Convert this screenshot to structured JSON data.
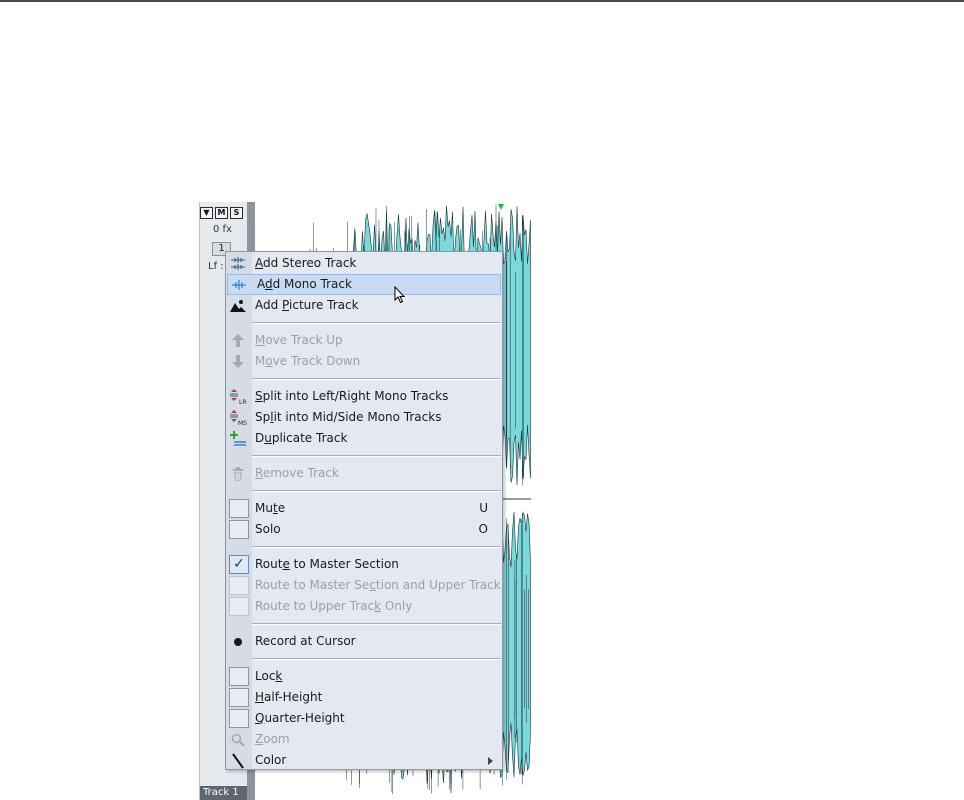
{
  "track": {
    "buttons": [
      "▼",
      "M",
      "S"
    ],
    "fx_label": "0 fx",
    "number": "1",
    "lf_label": "Lf :",
    "name": "Track 1"
  },
  "colors": {
    "waveform_fill": "#7dd8dc",
    "waveform_stroke": "#14353a",
    "menu_background": "#e4e9f1",
    "menu_highlight": "#c8dbf2",
    "disabled_text": "#9aa0a7"
  },
  "context_menu": {
    "groups": [
      [
        {
          "pre": "",
          "u": "A",
          "post": "dd Stereo Track",
          "icon": "stereo-track-icon",
          "disabled": false
        },
        {
          "pre": "A",
          "u": "d",
          "post": "d Mono Track",
          "icon": "mono-track-icon",
          "disabled": false,
          "highlighted": true
        },
        {
          "pre": "Add ",
          "u": "P",
          "post": "icture Track",
          "icon": "picture-track-icon",
          "disabled": false
        }
      ],
      [
        {
          "pre": "",
          "u": "M",
          "post": "ove Track Up",
          "icon": "arrow-up-icon",
          "disabled": true
        },
        {
          "pre": "M",
          "u": "o",
          "post": "ve Track Down",
          "icon": "arrow-down-icon",
          "disabled": true
        }
      ],
      [
        {
          "pre": "",
          "u": "S",
          "post": "plit into Left/Right Mono Tracks",
          "icon": "split-lr-icon",
          "disabled": false
        },
        {
          "pre": "Sp",
          "u": "l",
          "post": "it into Mid/Side Mono Tracks",
          "icon": "split-ms-icon",
          "disabled": false
        },
        {
          "pre": "D",
          "u": "u",
          "post": "plicate Track",
          "icon": "duplicate-track-icon",
          "disabled": false
        }
      ],
      [
        {
          "pre": "",
          "u": "R",
          "post": "emove Track",
          "icon": "trash-icon",
          "disabled": true
        }
      ],
      [
        {
          "pre": "Mu",
          "u": "t",
          "post": "e",
          "check": "unchecked",
          "shortcut": "U",
          "disabled": false
        },
        {
          "pre": "Solo",
          "u": "",
          "post": "",
          "check": "unchecked",
          "shortcut": "O",
          "disabled": false
        }
      ],
      [
        {
          "pre": "Rout",
          "u": "e",
          "post": " to Master Section",
          "check": "checked",
          "disabled": false
        },
        {
          "pre": "Route to Master Se",
          "u": "c",
          "post": "tion and Upper Track",
          "check": "unchecked",
          "disabled": true
        },
        {
          "pre": "Route to Upper Trac",
          "u": "k",
          "post": " Only",
          "check": "unchecked",
          "disabled": true
        }
      ],
      [
        {
          "pre": "Record at Cursor",
          "u": "",
          "post": "",
          "icon": "record-dot-icon",
          "disabled": false
        }
      ],
      [
        {
          "pre": "Loc",
          "u": "k",
          "post": "",
          "check": "unchecked",
          "disabled": false
        },
        {
          "pre": "",
          "u": "H",
          "post": "alf-Height",
          "check": "unchecked",
          "disabled": false
        },
        {
          "pre": "",
          "u": "Q",
          "post": "uarter-Height",
          "check": "unchecked",
          "disabled": false
        },
        {
          "pre": "",
          "u": "Z",
          "post": "oom",
          "icon": "magnifier-icon",
          "disabled": true
        },
        {
          "pre": "Color",
          "u": "",
          "post": "",
          "icon": "color-pen-icon",
          "disabled": false,
          "submenu": true
        }
      ]
    ]
  }
}
